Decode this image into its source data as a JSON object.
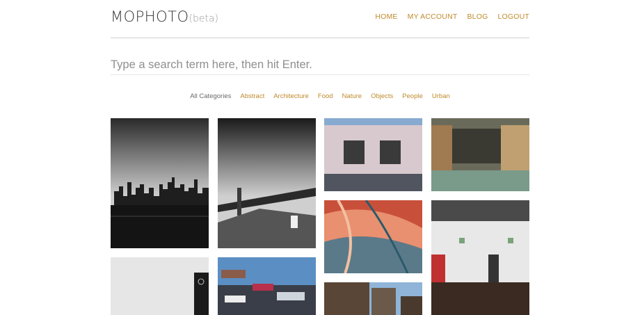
{
  "brand": {
    "name": "MOPHOTO",
    "badge": "(beta)"
  },
  "nav": [
    {
      "label": "HOME"
    },
    {
      "label": "MY ACCOUNT"
    },
    {
      "label": "BLOG"
    },
    {
      "label": "LOGOUT"
    }
  ],
  "search": {
    "placeholder": "Type a search term here, then hit Enter."
  },
  "categories": [
    {
      "label": "All Categories",
      "active": true
    },
    {
      "label": "Abstract"
    },
    {
      "label": "Architecture"
    },
    {
      "label": "Food"
    },
    {
      "label": "Nature"
    },
    {
      "label": "Objects"
    },
    {
      "label": "People"
    },
    {
      "label": "Urban"
    }
  ],
  "photos": [
    {
      "name": "city-skyline-bw"
    },
    {
      "name": "bridge-bw"
    },
    {
      "name": "garage-doors"
    },
    {
      "name": "warehouse-shelves"
    },
    {
      "name": "abstract-paint"
    },
    {
      "name": "coffee-bar"
    },
    {
      "name": "white-wall-sign"
    },
    {
      "name": "stacked-cars"
    },
    {
      "name": "buildings"
    }
  ],
  "colors": {
    "accent": "#c08a2c",
    "text": "#666666",
    "divider": "#cfcfcf"
  }
}
